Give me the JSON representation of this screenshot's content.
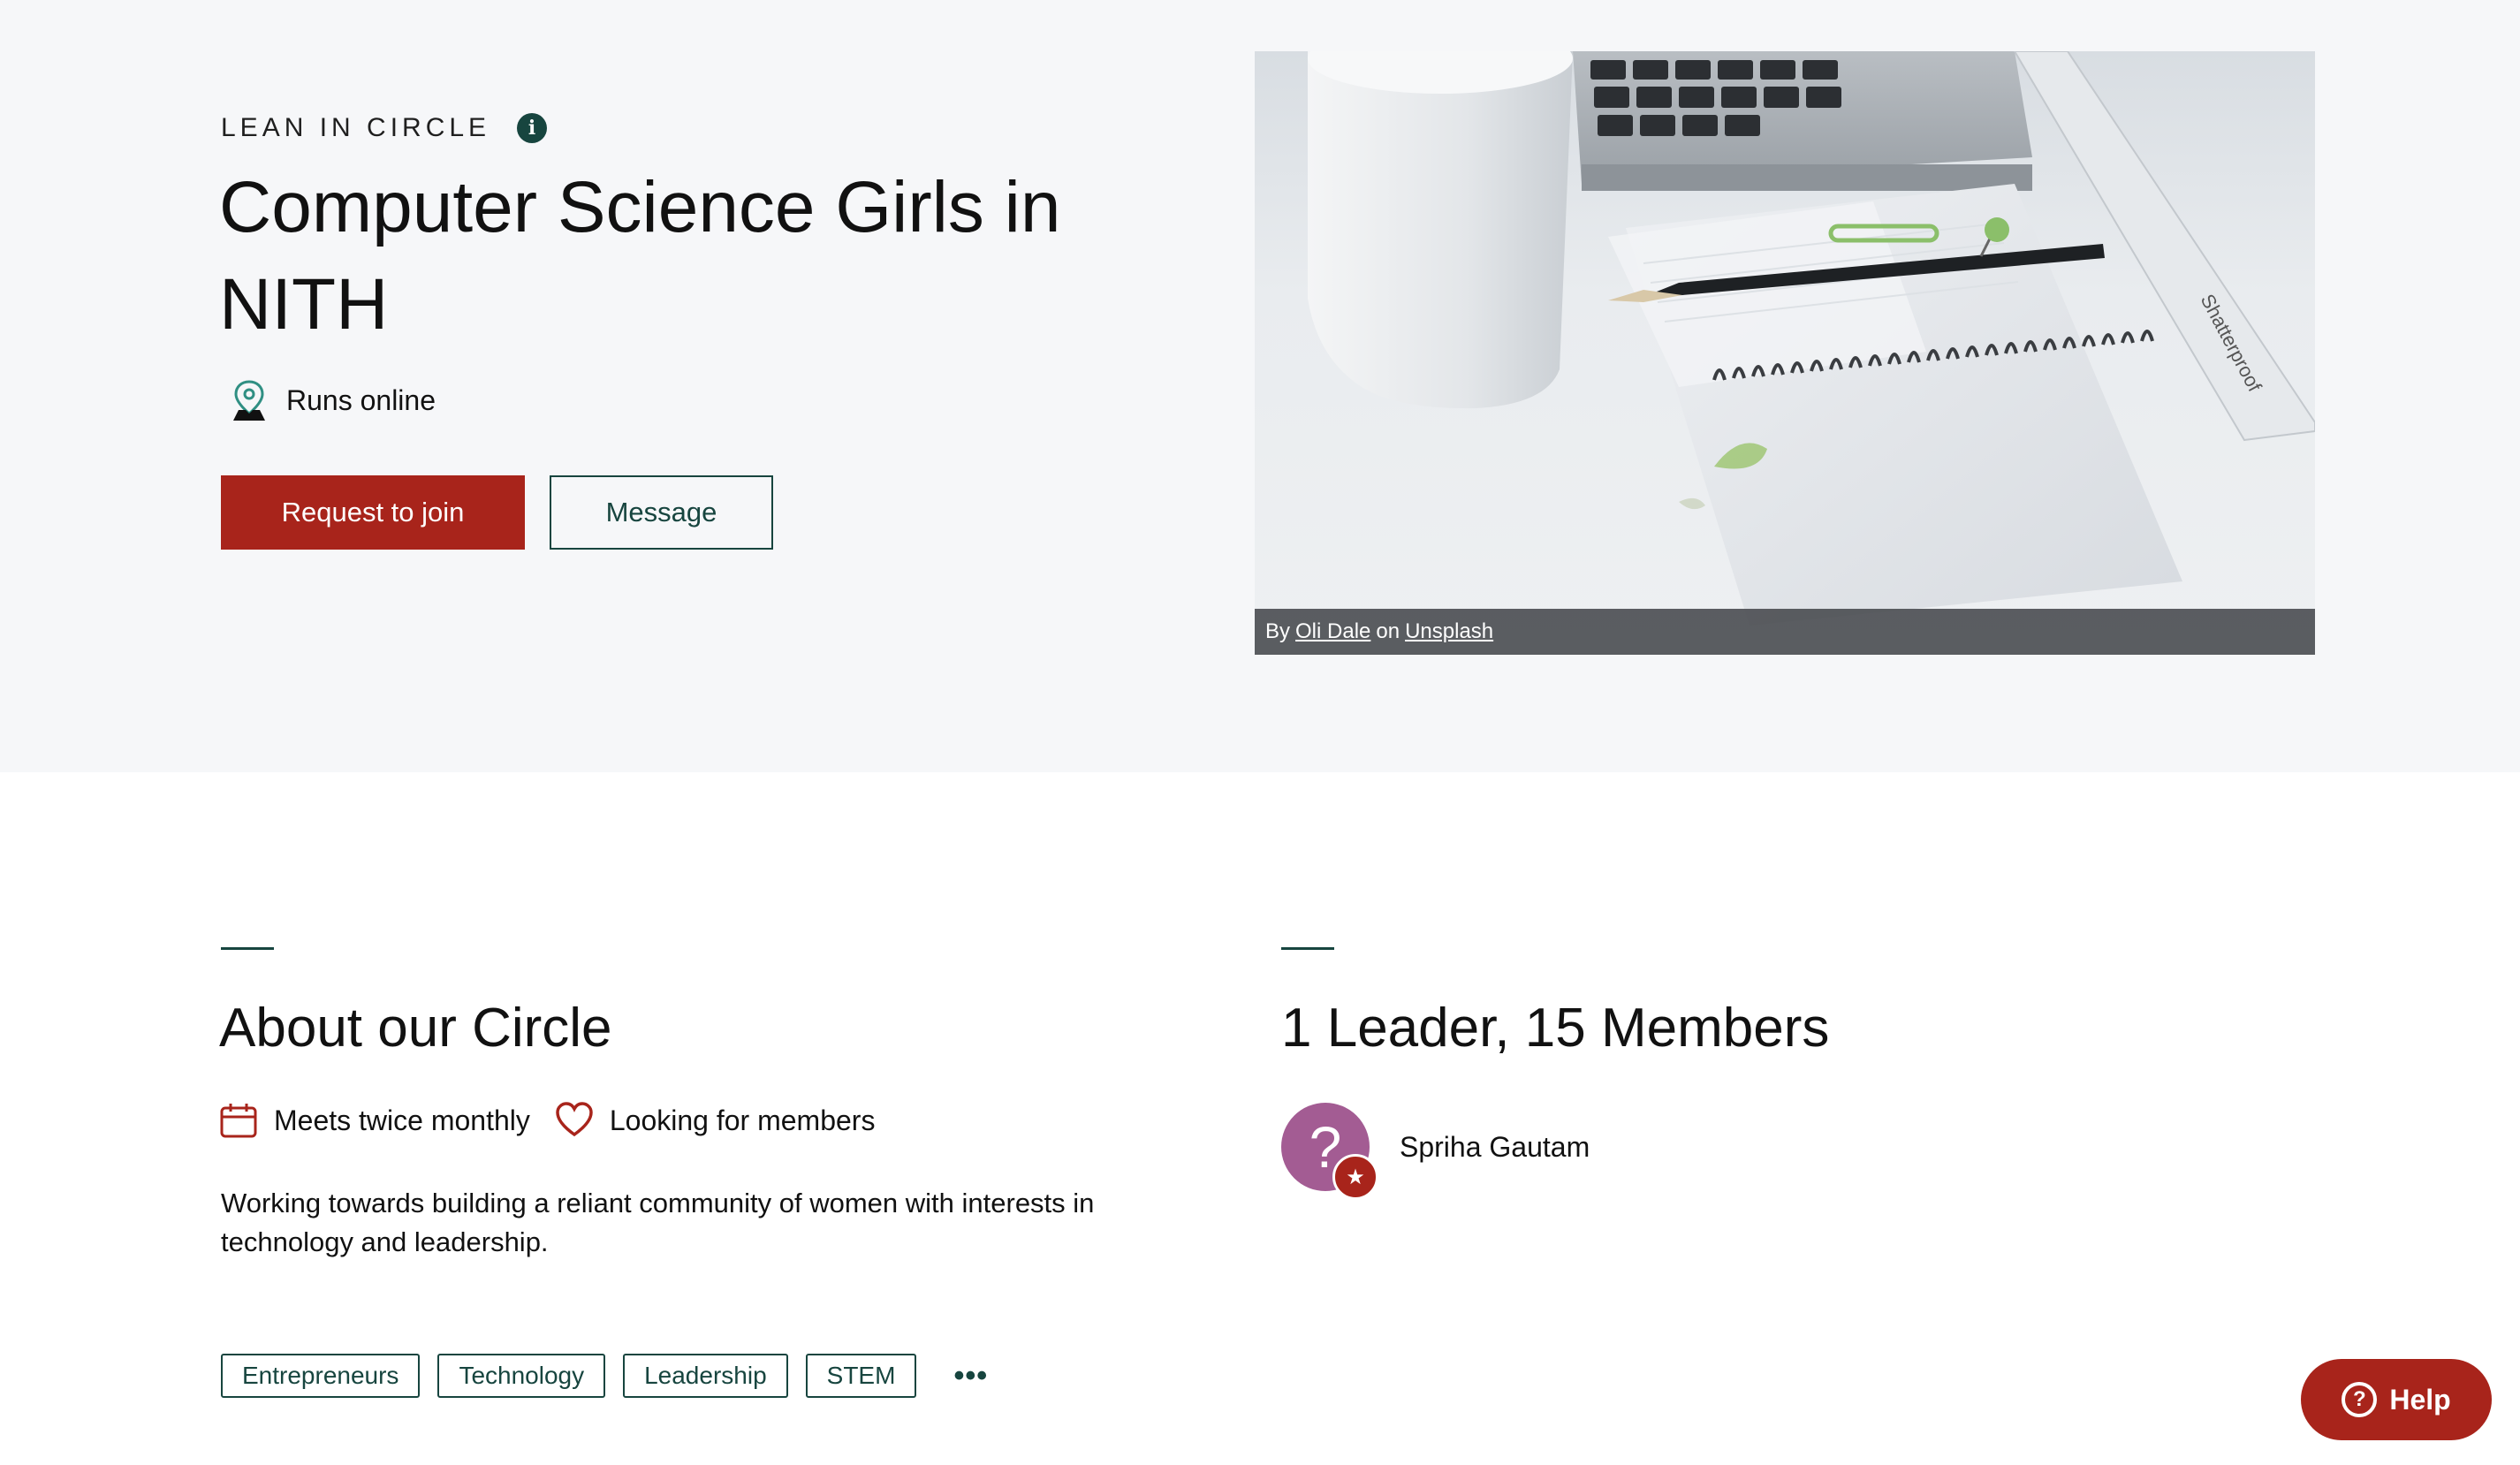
{
  "hero": {
    "eyebrow": "LEAN IN CIRCLE",
    "title": "Computer Science Girls in NITH",
    "location": "Runs online",
    "join_label": "Request to join",
    "message_label": "Message"
  },
  "photo": {
    "credit_by": "By",
    "author": "Oli Dale",
    "credit_on": "on",
    "source": "Unsplash",
    "ruler_text": "Shatterproof"
  },
  "about": {
    "title": "About our Circle",
    "meets": "Meets twice monthly",
    "looking": "Looking for members",
    "description": "Working towards building a reliant community of women with interests in technology and leadership.",
    "tags": [
      "Entrepreneurs",
      "Technology",
      "Leadership",
      "STEM"
    ]
  },
  "members": {
    "title": "1 Leader, 15 Members",
    "leader_name": "Spriha Gautam",
    "avatar_glyph": "?"
  },
  "help": {
    "label": "Help",
    "glyph": "?"
  },
  "colors": {
    "accent": "#a8241b",
    "dark_green": "#17453f",
    "hero_bg": "#f6f7f9",
    "avatar": "#a35c93"
  },
  "icons": [
    "info-icon",
    "location-pin-icon",
    "calendar-icon",
    "heart-icon",
    "more-dots-icon",
    "star-icon",
    "question-icon"
  ]
}
